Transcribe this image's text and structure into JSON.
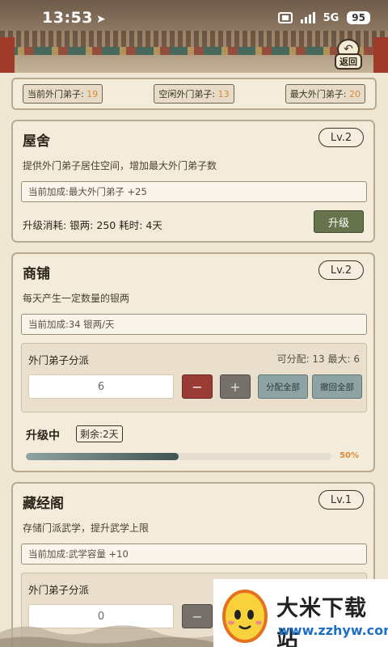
{
  "status_bar": {
    "time": "13:53",
    "network": "5G",
    "battery": "95"
  },
  "header": {
    "back_label": "返回"
  },
  "stats": [
    {
      "label": "当前外门弟子: ",
      "value": "19"
    },
    {
      "label": "空闲外门弟子: ",
      "value": "13"
    },
    {
      "label": "最大外门弟子: ",
      "value": "20"
    }
  ],
  "buildings": {
    "dorm": {
      "title": "屋舍",
      "level": "Lv.2",
      "desc": "提供外门弟子居住空间，增加最大外门弟子数",
      "bonus": "当前加成:最大外门弟子 +25",
      "cost": "升级消耗: 银两: 250  耗时: 4天",
      "upgrade": "升级"
    },
    "shop": {
      "title": "商铺",
      "level": "Lv.2",
      "desc": "每天产生一定数量的银两",
      "bonus": "当前加成:34 银两/天",
      "assign_title": "外门弟子分派",
      "assign_info": "可分配: 13  最大: 6",
      "assign_value": "6",
      "minus": "−",
      "plus": "+",
      "assign_all": "分配全部",
      "recall_all": "撤回全部",
      "progress_label": "升级中",
      "remain": "剩余:2天",
      "progress_pct": "50%",
      "progress": 0.5
    },
    "library": {
      "title": "藏经阁",
      "level": "Lv.1",
      "desc": "存储门派武学，提升武学上限",
      "bonus": "当前加成:武学容量 +10",
      "assign_title": "外门弟子分派",
      "assign_value": "0",
      "minus": "−"
    }
  },
  "watermark": {
    "title": "大米下载站",
    "url": "www.zzhyw.com"
  },
  "colors": {
    "accent_orange": "#d88a3a",
    "upgrade_green": "#66734c",
    "minus_red": "#9a3b36",
    "teal_button": "#8ea4a4"
  }
}
